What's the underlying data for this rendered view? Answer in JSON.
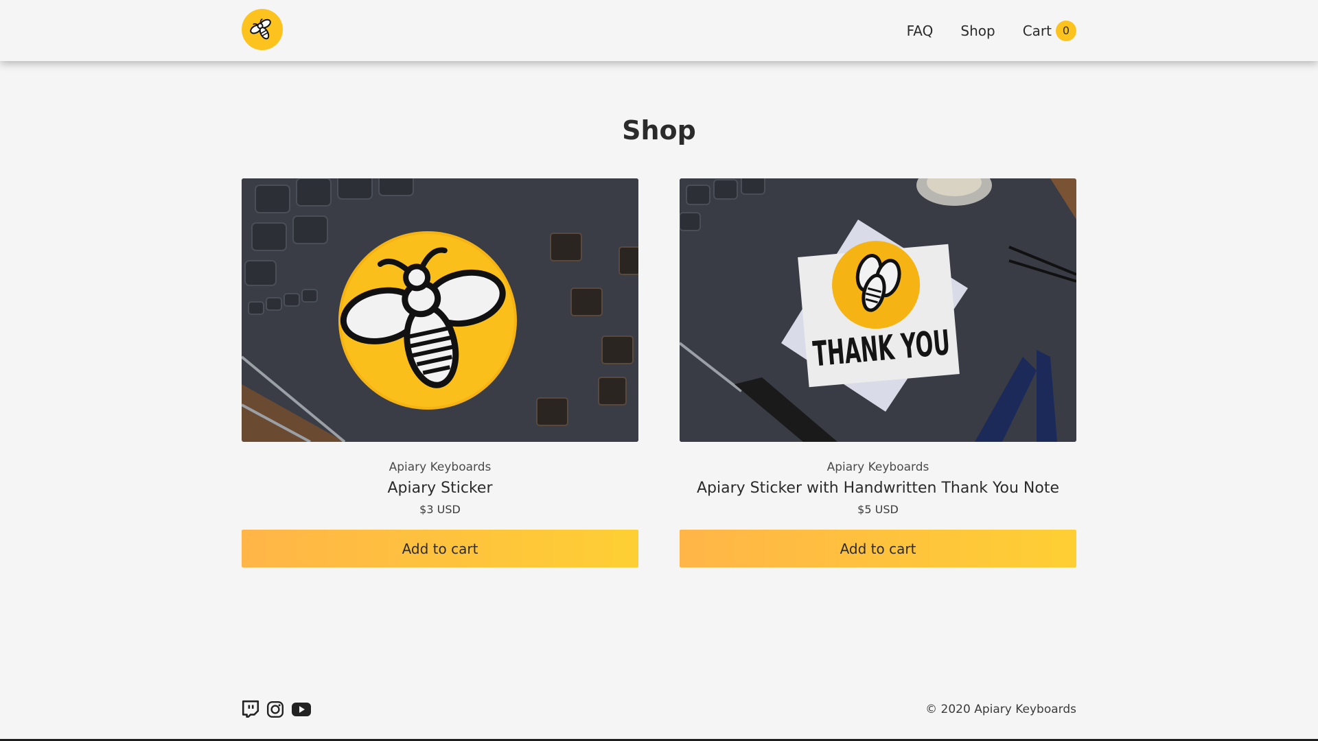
{
  "header": {
    "logo_icon": "bee-logo-icon",
    "nav": {
      "faq": "FAQ",
      "shop": "Shop",
      "cart": "Cart",
      "cart_count": "0"
    }
  },
  "main": {
    "title": "Shop",
    "products": [
      {
        "vendor": "Apiary Keyboards",
        "name": "Apiary Sticker",
        "price": "$3 USD",
        "button": "Add to cart"
      },
      {
        "vendor": "Apiary Keyboards",
        "name": "Apiary Sticker with Handwritten Thank You Note",
        "price": "$5 USD",
        "button": "Add to cart",
        "image_text": "THANK YOU"
      }
    ]
  },
  "footer": {
    "social": [
      "twitch-icon",
      "instagram-icon",
      "youtube-icon"
    ],
    "copyright": "© 2020 Apiary Keyboards"
  },
  "colors": {
    "accent": "#fcc31f",
    "button_gradient_start": "#ffb547",
    "button_gradient_end": "#fecf34",
    "background": "#f5f5f5",
    "text": "#2b2b2b"
  }
}
